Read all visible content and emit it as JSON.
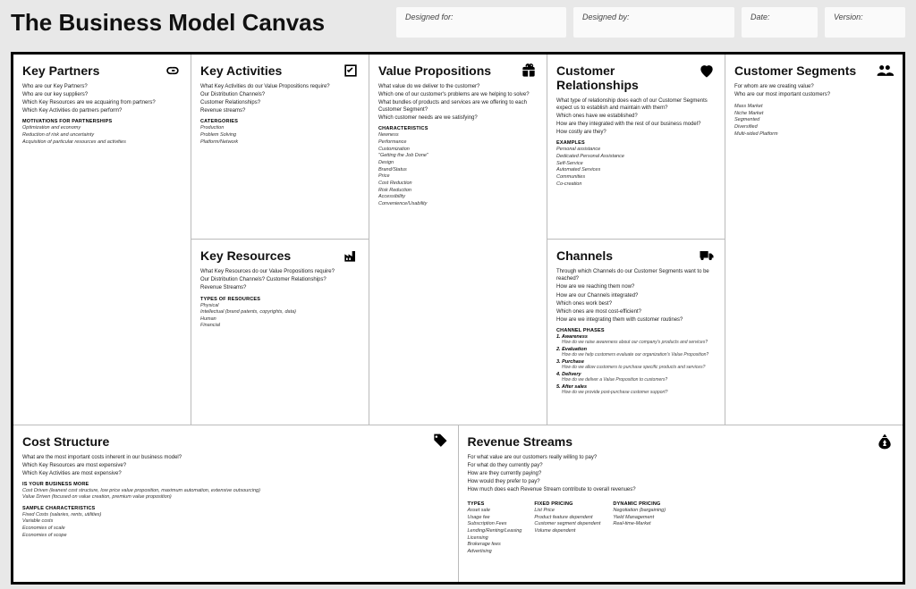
{
  "header": {
    "title": "The Business Model Canvas",
    "designed_for": "Designed for:",
    "designed_by": "Designed by:",
    "date": "Date:",
    "version": "Version:"
  },
  "keyPartners": {
    "title": "Key Partners",
    "questions": [
      "Who are our Key Partners?",
      "Who are our key suppliers?",
      "Which Key Resources are we acquairing from partners?",
      "Which Key Activities do partners perform?"
    ],
    "subhead": "MOTIVATIONS FOR PARTNERSHIPS",
    "items": [
      "Optimization and economy",
      "Reduction of risk and uncertainty",
      "Acquisition of particular resources and activities"
    ]
  },
  "keyActivities": {
    "title": "Key Activities",
    "questions": [
      "What Key Activities do our Value Propositions require?",
      "Our Distribution Channels?",
      "Customer Relationships?",
      "Revenue streams?"
    ],
    "subhead": "CATERGORIES",
    "items": [
      "Production",
      "Problem Solving",
      "Platform/Network"
    ]
  },
  "keyResources": {
    "title": "Key Resources",
    "questions": [
      "What Key Resources do our Value Propositions require?",
      "Our Distribution Channels? Customer Relationships?",
      "Revenue Streams?"
    ],
    "subhead": "TYPES OF RESOURCES",
    "items": [
      "Physical",
      "Intellectual (brand patents, copyrights, data)",
      "Human",
      "Financial"
    ]
  },
  "valueProps": {
    "title": "Value Propositions",
    "questions": [
      "What value do we deliver to the customer?",
      "Which one of our customer's problems are we helping to solve?",
      "What bundles of products and services are we offering to each Customer Segment?",
      "Which customer needs are we satisfying?"
    ],
    "subhead": "CHARACTERISTICS",
    "items": [
      "Newness",
      "Performance",
      "Customization",
      "\"Getting the Job Done\"",
      "Design",
      "Brand/Status",
      "Price",
      "Cost Reduction",
      "Risk Reduction",
      "Accessibility",
      "Convenience/Usability"
    ]
  },
  "customerRel": {
    "title": "Customer Relationships",
    "questions": [
      "What type of relationship does each of our Customer Segments expect us to establish and maintain with them?",
      "Which ones have we established?",
      "How are they integrated with the rest of our business model?",
      "How costly are they?"
    ],
    "subhead": "EXAMPLES",
    "items": [
      "Personal assistance",
      "Dedicated Personal Assistance",
      "Self-Service",
      "Automated Services",
      "Communities",
      "Co-creation"
    ]
  },
  "channels": {
    "title": "Channels",
    "questions": [
      "Through which Channels do our Customer Segments want to be reached?",
      "How are we reaching them now?",
      "How are our Channels integrated?",
      "Which ones work best?",
      "Which ones are most cost-efficient?",
      "How are we integrating them with customer routines?"
    ],
    "subhead": "CHANNEL PHASES",
    "phases": [
      {
        "t": "1. Awareness",
        "s": "How do we raise awareness about our company's products and services?"
      },
      {
        "t": "2. Evaluation",
        "s": "How do we help customers evaluate our organization's Value Proposition?"
      },
      {
        "t": "3. Purchase",
        "s": "How do we allow customers to purchase specific products and services?"
      },
      {
        "t": "4. Delivery",
        "s": "How do we deliver a Value Proposition to customers?"
      },
      {
        "t": "5. After sales",
        "s": "How do we provide post-purchase customer support?"
      }
    ]
  },
  "customerSeg": {
    "title": "Customer Segments",
    "questions": [
      "For whom are we creating value?",
      "Who are our most important customers?"
    ],
    "items": [
      "Mass Market",
      "Niche Market",
      "Segmented",
      "Diversified",
      "Multi-sided Platform"
    ]
  },
  "costStructure": {
    "title": "Cost Structure",
    "questions": [
      "What are the most important costs inherent in our business model?",
      "Which Key Resources are most expensive?",
      "Which Key Activities are most expensive?"
    ],
    "subhead1": "IS YOUR BUSINESS MORE",
    "items1": [
      "Cost Driven (leanest cost structure, low price value proposition, maximum automation, extensive outsourcing)",
      "Value Driven (focused on value creation, premium value proposition)"
    ],
    "subhead2": "SAMPLE CHARACTERISTICS",
    "items2": [
      "Fixed Costs (salaries, rents, utilities)",
      "Variable costs",
      "Economies of scale",
      "Economies of scope"
    ]
  },
  "revenueStreams": {
    "title": "Revenue Streams",
    "questions": [
      "For what value are our customers really willing to pay?",
      "For what do they currently pay?",
      "How are they currently paying?",
      "How would they prefer to pay?",
      "How much does each Revenue Stream contribute to overall revenues?"
    ],
    "col1head": "TYPES",
    "col1": [
      "Asset sale",
      "Usage fee",
      "Subscription Fees",
      "Lending/Renting/Leasing",
      "Licensing",
      "Brokerage fees",
      "Advertising"
    ],
    "col2head": "FIXED PRICING",
    "col2": [
      "List Price",
      "Product feature dependent",
      "Customer segment dependent",
      "Volume dependent"
    ],
    "col3head": "DYNAMIC PRICING",
    "col3": [
      "Negotiation (bargaining)",
      "Yield Management",
      "Real-time-Market"
    ]
  }
}
